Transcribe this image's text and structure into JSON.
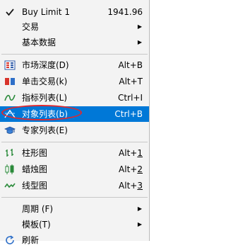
{
  "menu": {
    "buy_limit": {
      "label": "Buy Limit 1",
      "value": "1941.96"
    },
    "trade": {
      "label": "交易"
    },
    "fundamentals": {
      "label": "基本数据"
    },
    "market_depth": {
      "label": "市场深度(D)",
      "shortcut": "Alt+B"
    },
    "one_click": {
      "label": "单击交易(k)",
      "shortcut": "Alt+T"
    },
    "indicators": {
      "label": "指标列表(L)",
      "shortcut": "Ctrl+I"
    },
    "objects": {
      "label": "对象列表(b)",
      "shortcut": "Ctrl+B"
    },
    "experts": {
      "label": "专家列表(E)"
    },
    "bar_chart": {
      "label": "柱形图",
      "shortcut_prefix": "Alt+",
      "shortcut_key": "1"
    },
    "candles": {
      "label": "蜡烛图",
      "shortcut_prefix": "Alt+",
      "shortcut_key": "2"
    },
    "line_chart": {
      "label": "线型图",
      "shortcut_prefix": "Alt+",
      "shortcut_key": "3"
    },
    "period": {
      "label": "周期 (F)"
    },
    "template": {
      "label": "模板(T)"
    },
    "refresh": {
      "label": "刷新"
    }
  },
  "colors": {
    "highlight": "#0078d7",
    "annotation": "#e0282e",
    "menu_bg": "#f3f3f3"
  }
}
